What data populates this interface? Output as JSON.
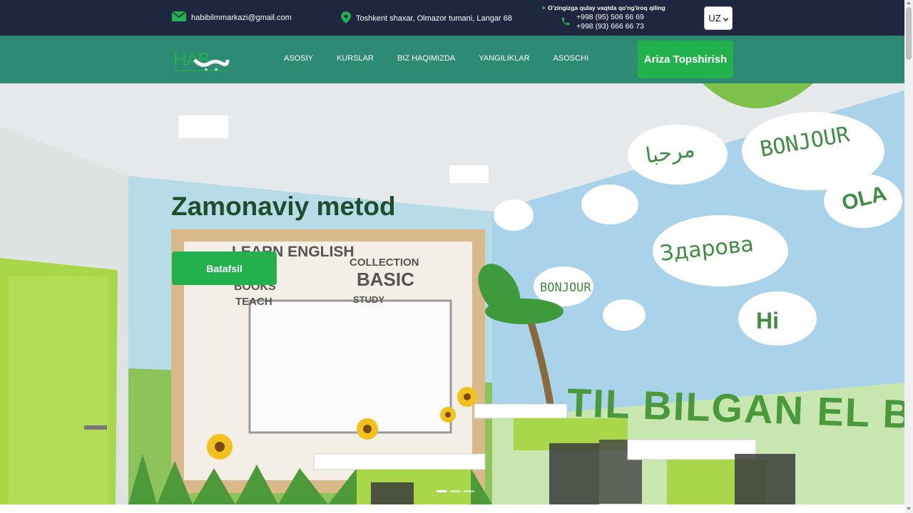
{
  "topbar": {
    "email": "habibilmmarkazi@gmail.com",
    "address": "Toshkent shaxar, Olmazor tumani, Langar 68",
    "call_cta": "O'zingizga qulay vaqtda qo'ng'iroq qiling",
    "phones": [
      "+998 (95) 506 66 69",
      "+998 (93) 666 66 73"
    ],
    "language": "UZ",
    "icons": {
      "email": "envelope-icon",
      "address": "map-pin-icon",
      "phone": "phone-icon"
    }
  },
  "navbar": {
    "logo_alt": "HABIB",
    "items": [
      {
        "label": "ASOSIY"
      },
      {
        "label": "KURSLAR"
      },
      {
        "label": "BIZ HAQIMIZDA"
      },
      {
        "label": "YANGILIKLAR"
      },
      {
        "label": "ASOSCHI"
      }
    ],
    "apply_button": "Ariza Topshirish"
  },
  "hero": {
    "title": "Zamonaviy metod",
    "button": "Batafsil",
    "wall_slogan": "TIL BILGAN EL BIL",
    "cloud_words": [
      "مرحبا",
      "BONJOUR",
      "OLA",
      "Здарова",
      "Hi",
      "BONJOUR"
    ],
    "board_words": [
      "LEARN ENGLISH",
      "BOOKS",
      "BASIC",
      "COLLECTION",
      "TEACH",
      "STUDY"
    ],
    "slides": {
      "count": 3,
      "active": 1
    }
  },
  "colors": {
    "topbar_bg": "#1f2740",
    "navbar_bg": "#2e8b73",
    "accent_green": "#22b14c",
    "hero_title": "#1e4d2b"
  }
}
